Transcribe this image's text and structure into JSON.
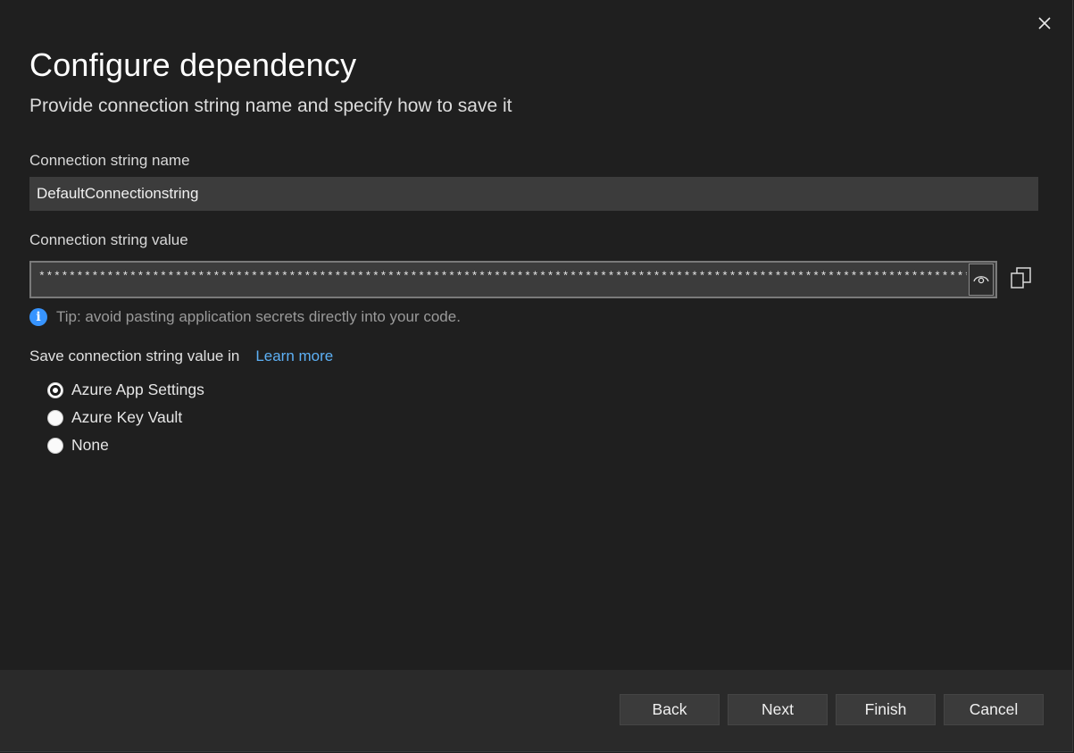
{
  "dialog": {
    "title": "Configure dependency",
    "subtitle": "Provide connection string name and specify how to save it"
  },
  "connection_name": {
    "label": "Connection string name",
    "value": "DefaultConnectionstring"
  },
  "connection_value": {
    "label": "Connection string value",
    "masked_value": "*********************************************************************************************************************************************"
  },
  "tip": {
    "text": "Tip: avoid pasting application secrets directly into your code."
  },
  "save_in": {
    "label": "Save connection string value in",
    "learn_more": "Learn more",
    "options": [
      {
        "label": "Azure App Settings",
        "selected": true
      },
      {
        "label": "Azure Key Vault",
        "selected": false
      },
      {
        "label": "None",
        "selected": false
      }
    ]
  },
  "footer": {
    "back": "Back",
    "next": "Next",
    "finish": "Finish",
    "cancel": "Cancel"
  },
  "icons": {
    "close": "close-icon",
    "reveal": "eye-icon",
    "copy": "copy-icon",
    "info": "info-icon"
  },
  "colors": {
    "background": "#1f1f1f",
    "footer": "#2a2a2a",
    "input": "#3c3c3c",
    "link": "#5db0f5",
    "info": "#3794ff"
  }
}
